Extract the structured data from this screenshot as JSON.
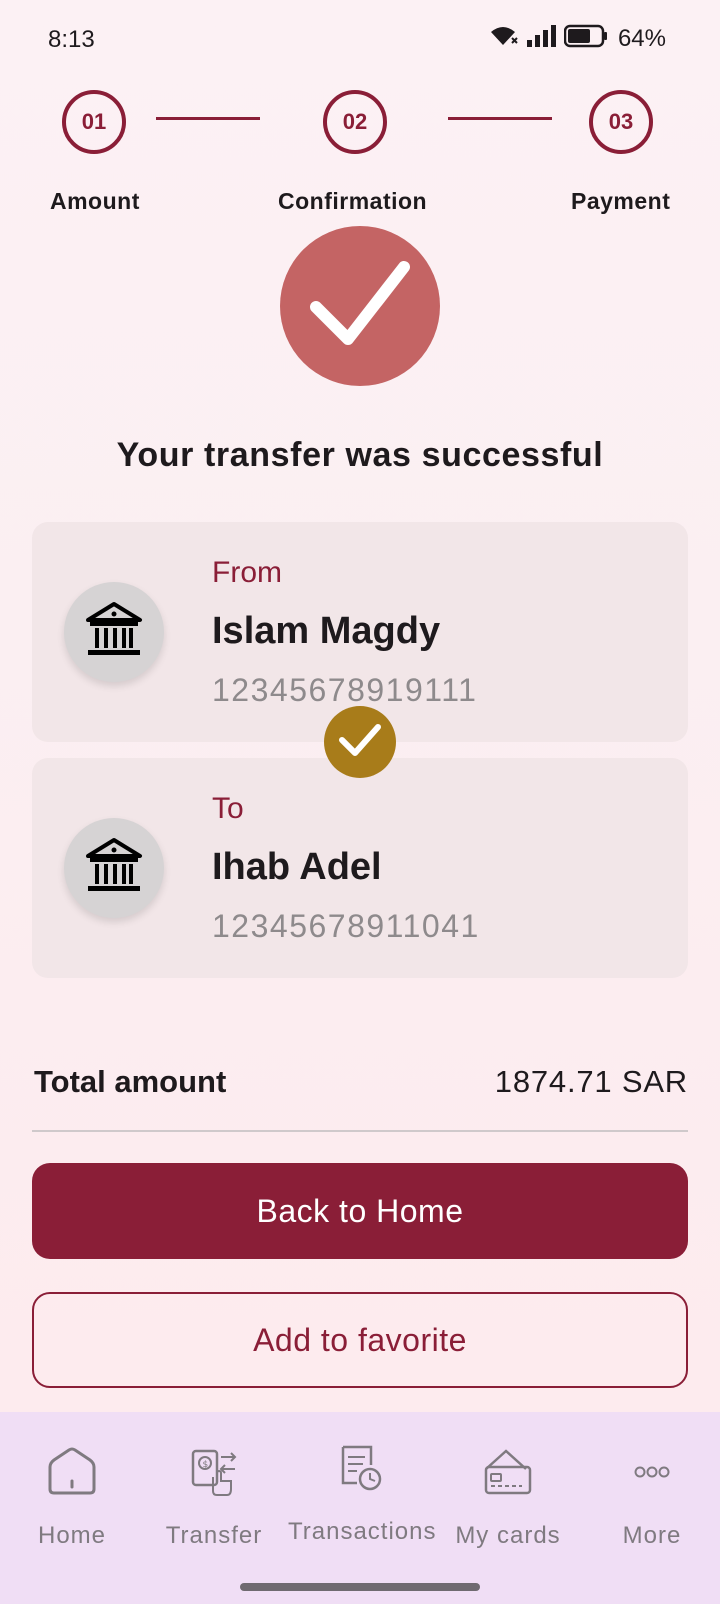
{
  "status_bar": {
    "time": "8:13",
    "battery_percent": "64%",
    "icons": [
      "wifi-icon",
      "signal-icon",
      "battery-icon"
    ]
  },
  "stepper": {
    "steps": [
      {
        "number": "01",
        "label": "Amount"
      },
      {
        "number": "02",
        "label": "Confirmation"
      },
      {
        "number": "03",
        "label": "Payment"
      }
    ]
  },
  "success": {
    "icon": "checkmark-icon",
    "title": "Your transfer was successful"
  },
  "from_card": {
    "role": "From",
    "name": "Islam Magdy",
    "account": "12345678919111",
    "icon": "bank-icon"
  },
  "to_card": {
    "role": "To",
    "name": "Ihab Adel",
    "account": "12345678911041",
    "icon": "bank-icon"
  },
  "total": {
    "label": "Total amount",
    "value": "1874.71 SAR"
  },
  "actions": {
    "primary_label": "Back to Home",
    "secondary_label": "Add to favorite"
  },
  "bottom_nav": {
    "items": [
      {
        "label": "Home",
        "icon": "home-icon"
      },
      {
        "label": "Transfer",
        "icon": "transfer-icon"
      },
      {
        "label": "Transactions",
        "icon": "transactions-icon"
      },
      {
        "label": "My cards",
        "icon": "cards-icon"
      },
      {
        "label": "More",
        "icon": "more-icon"
      }
    ]
  },
  "colors": {
    "primary": "#8a1e37",
    "success_circle": "#c46464",
    "gold_check": "#a87c1a",
    "card_bg": "#f2e6e8",
    "nav_bg": "#f0def5"
  }
}
